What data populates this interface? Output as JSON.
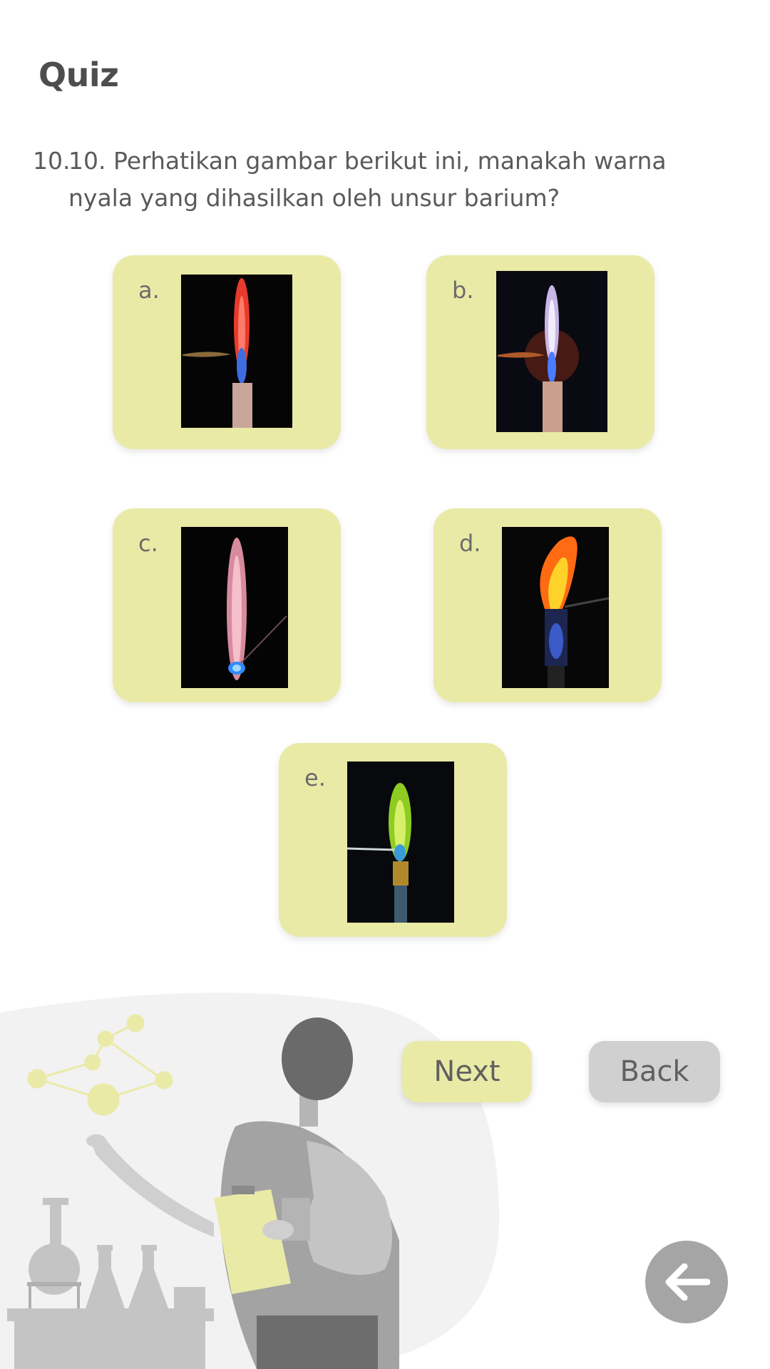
{
  "header": {
    "title": "Quiz"
  },
  "question": {
    "number": "10.",
    "line1": "10. Perhatikan gambar berikut ini, manakah warna",
    "line2": "nyala yang dihasilkan oleh unsur barium?"
  },
  "options": [
    {
      "letter": "a.",
      "flame": "red"
    },
    {
      "letter": "b.",
      "flame": "violet-orange"
    },
    {
      "letter": "c.",
      "flame": "pink"
    },
    {
      "letter": "d.",
      "flame": "orange-yellow"
    },
    {
      "letter": "e.",
      "flame": "green"
    }
  ],
  "buttons": {
    "next": "Next",
    "back": "Back"
  },
  "icons": {
    "back": "arrow-left-icon"
  },
  "colors": {
    "card": "#eaeaa7",
    "back_button": "#d0d0d0",
    "circle_button": "#a5a5a5"
  }
}
